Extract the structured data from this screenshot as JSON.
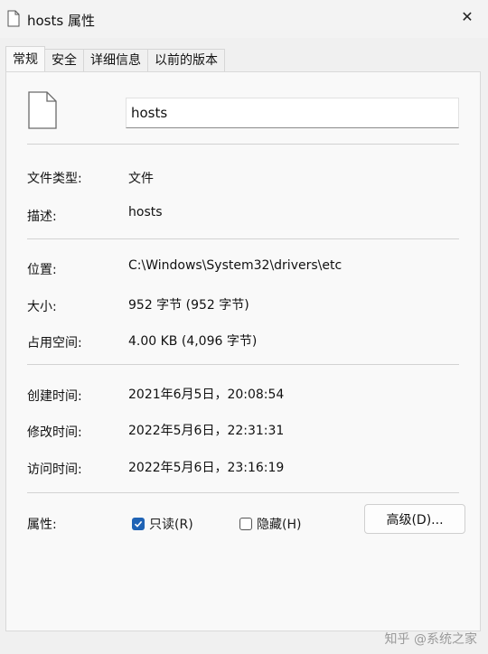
{
  "window": {
    "title": "hosts 属性",
    "close_glyph": "✕"
  },
  "tabs": [
    {
      "label": "常规",
      "active": true
    },
    {
      "label": "安全",
      "active": false
    },
    {
      "label": "详细信息",
      "active": false
    },
    {
      "label": "以前的版本",
      "active": false
    }
  ],
  "general": {
    "file_name": "hosts",
    "type_label": "文件类型:",
    "type_value": "文件",
    "description_label": "描述:",
    "description_value": "hosts",
    "location_label": "位置:",
    "location_value": "C:\\Windows\\System32\\drivers\\etc",
    "size_label": "大小:",
    "size_value": "952 字节 (952 字节)",
    "size_on_disk_label": "占用空间:",
    "size_on_disk_value": "4.00 KB (4,096 字节)",
    "created_label": "创建时间:",
    "created_value": "2021年6月5日，20:08:54",
    "modified_label": "修改时间:",
    "modified_value": "2022年5月6日，22:31:31",
    "accessed_label": "访问时间:",
    "accessed_value": "2022年5月6日，23:16:19",
    "attributes_label": "属性:",
    "readonly_label": "只读(R)",
    "readonly_checked": true,
    "hidden_label": "隐藏(H)",
    "hidden_checked": false,
    "advanced_button": "高级(D)..."
  },
  "watermark": "知乎 @系统之家",
  "colors": {
    "accent": "#1f63b5",
    "panel_bg": "#f9f9f9",
    "window_bg": "#f0f0f0"
  }
}
